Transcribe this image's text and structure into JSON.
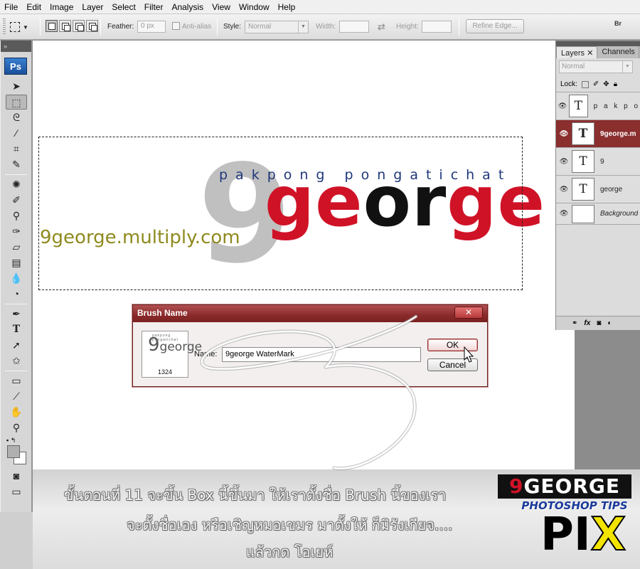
{
  "menu": [
    "File",
    "Edit",
    "Image",
    "Layer",
    "Select",
    "Filter",
    "Analysis",
    "View",
    "Window",
    "Help"
  ],
  "options": {
    "feather_label": "Feather:",
    "feather_value": "0 px",
    "antialias_label": "Anti-alias",
    "style_label": "Style:",
    "style_value": "Normal",
    "width_label": "Width:",
    "height_label": "Height:",
    "refine_edge": "Refine Edge...",
    "bridge": "Br"
  },
  "toolbox": {
    "logo": "Ps"
  },
  "canvas": {
    "small_text": "pakpong pongatichat",
    "nine": "9",
    "big_e1": "ge",
    "big_o": "or",
    "big_e2": "ge",
    "url": "9george.multiply.com"
  },
  "layers_panel": {
    "tabs": [
      "Layers",
      "Channels"
    ],
    "blend_mode": "Normal",
    "lock_label": "Lock:",
    "layers": [
      {
        "name": "p a k p o n",
        "thumb": "T",
        "selected": false
      },
      {
        "name": "9george.m",
        "thumb": "T",
        "selected": true
      },
      {
        "name": "9",
        "thumb": "T",
        "selected": false
      },
      {
        "name": "george",
        "thumb": "T",
        "selected": false
      },
      {
        "name": "Background",
        "thumb": "",
        "selected": false
      }
    ]
  },
  "dialog": {
    "title": "Brush Name",
    "close": "✕",
    "preview_size": "1324",
    "name_label": "Name:",
    "name_value": "9george WaterMark",
    "ok": "OK",
    "cancel": "Cancel"
  },
  "caption": {
    "line1": "ขั้นตอนที่ 11 จะขึ้น Box นี้ขึ้นมา ให้เราตั้งชื่อ Brush นี้ของเรา",
    "line2": "จะตั้งชื่อเอง หรือเชิญหมอเขมร มาตั้งให้ ก็มิรังเกียจ....",
    "line3": "แล้วกด โอเยห์"
  },
  "badge": {
    "top_a": "9",
    "top_b": "GEORGE",
    "tips": "PHOTOSHOP TIPS",
    "pix": "PI",
    "x": "X"
  },
  "colors": {
    "brand_red": "#d01227",
    "brand_navy": "#1f3779",
    "brand_olive": "#8e8a1f",
    "dialog_title": "#8a2a2a",
    "selected_layer": "#8a2e2e"
  }
}
